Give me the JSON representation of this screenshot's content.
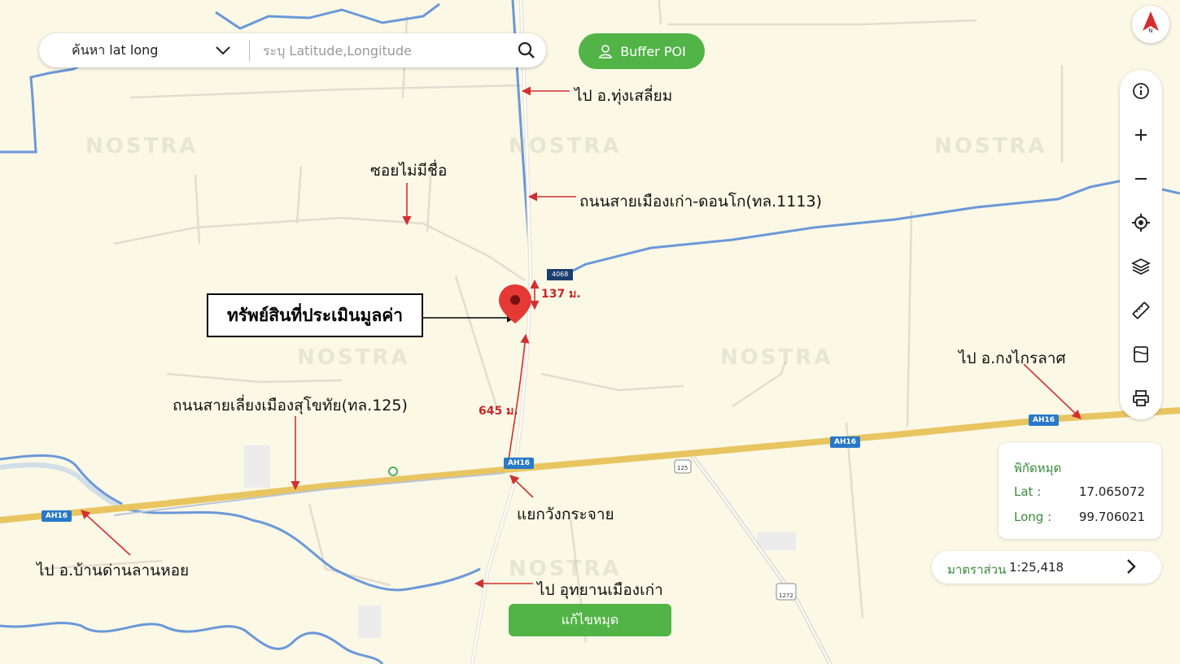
{
  "search": {
    "mode_label": "ค้นหา lat long",
    "placeholder": "ระบุ Latitude,Longitude"
  },
  "buffer_button": {
    "label": "Buffer POI"
  },
  "compass": {
    "label": "N"
  },
  "toolbar": {
    "tools": [
      "info-icon",
      "zoom-in-icon",
      "zoom-out-icon",
      "locate-icon",
      "layers-icon",
      "ruler-icon",
      "street-view-icon",
      "print-icon"
    ]
  },
  "coordinates": {
    "title": "พิกัดหมุด",
    "lat_label": "Lat :",
    "lat_value": "17.065072",
    "long_label": "Long :",
    "long_value": "99.706021"
  },
  "scale": {
    "label": "มาตราส่วน",
    "value": "1:25,418"
  },
  "edit_button": {
    "label": "แก้ไขหมุด"
  },
  "annotations": {
    "thung_saliam": "ไป อ.ทุ่งเสลี่ยม",
    "unnamed_soi": "ซอยไม่มีชื่อ",
    "road_1113": "ถนนสายเมืองเก่า-ดอนโก(ทล.1113)",
    "asset": "ทรัพย์สินที่ประเมินมูลค่า",
    "kong_krailat": "ไป อ.กงไกรลาศ",
    "bypass_125": "ถนนสายเลี่ยงเมืองสุโขทัย(ทล.125)",
    "wang_krachai": "แยกวังกระจาย",
    "ban_dan": "ไป อ.บ้านด่านลานหอย",
    "historical_park": "ไป อุทยานเมืองเก่า",
    "dist_137": "137 ม.",
    "dist_645": "645 ม."
  },
  "road_shields": {
    "ah16_a": "AH16",
    "ah16_b": "AH16",
    "ah16_c": "AH16",
    "ah16_d": "AH16",
    "r4068": "4068",
    "r125": "125",
    "r1272": "1272"
  },
  "watermark": "NOSTRA",
  "colors": {
    "map_bg": "#fbf8e6",
    "highway": "#e8c560",
    "water": "#6b98d8",
    "accent_green": "#52b447",
    "annotation_red": "#d32f2f",
    "pin_red": "#e53935"
  }
}
